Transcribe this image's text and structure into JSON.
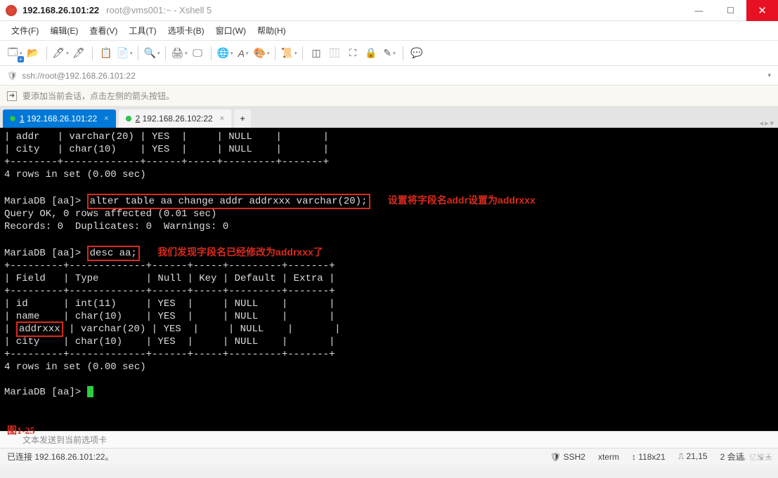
{
  "window": {
    "title_ip": "192.168.26.101:22",
    "title_sub": "root@vms001:~ - Xshell 5",
    "min": "—",
    "max": "☐",
    "close": "✕"
  },
  "menu": {
    "file": "文件(F)",
    "edit": "编辑(E)",
    "view": "查看(V)",
    "tools": "工具(T)",
    "tabs": "选项卡(B)",
    "window": "窗口(W)",
    "help": "帮助(H)"
  },
  "toolbar_icons": {
    "new_session": "🗔",
    "open": "📂",
    "reconnect": "🖊",
    "disconnect": "🖊",
    "copy": "📋",
    "paste": "📄",
    "find": "🔍",
    "print": "🖨",
    "properties": "🖵",
    "globe": "🌐",
    "font": "A",
    "colors": "🎨",
    "script": "📜",
    "layout1": "◫",
    "layout2": "⿲",
    "fullscreen": "⛶",
    "lock": "🔒",
    "highlight": "✎",
    "chat": "💬"
  },
  "addressbar": {
    "lock_icon": "🛡",
    "url": "ssh://root@192.168.26.101:22",
    "dd": "▾"
  },
  "tipbar": {
    "arrow": "➜",
    "text": "要添加当前会话，点击左侧的箭头按钮。"
  },
  "tabs": {
    "t1_num": "1",
    "t1_label": " 192.168.26.101:22",
    "t2_num": "2",
    "t2_label": " 192.168.26.102:22",
    "add": "+",
    "nav_left": "◂",
    "nav_right": "▸",
    "nav_dd": "▾"
  },
  "terminal": {
    "l1": "| addr   | varchar(20) | YES  |     | NULL    |       |",
    "l2": "| city   | char(10)    | YES  |     | NULL    |       |",
    "l3": "+--------+-------------+------+-----+---------+-------+",
    "l4": "4 rows in set (0.00 sec)",
    "p1": "MariaDB [aa]> ",
    "cmd1": "alter table aa change addr addrxxx varchar(20);",
    "ann1": "设置将字段名addr设置为addrxxx",
    "l6": "Query OK, 0 rows affected (0.01 sec)",
    "l7": "Records: 0  Duplicates: 0  Warnings: 0",
    "p2": "MariaDB [aa]> ",
    "cmd2": "desc aa;",
    "ann2": "我们发现字段名已经修改为addrxxx了",
    "h1": "+---------+-------------+------+-----+---------+-------+",
    "h2": "| Field   | Type        | Null | Key | Default | Extra |",
    "h3": "+---------+-------------+------+-----+---------+-------+",
    "r1": "| id      | int(11)     | YES  |     | NULL    |       |",
    "r2": "| name    | char(10)    | YES  |     | NULL    |       |",
    "r3a": "| ",
    "r3_field": "addrxxx",
    "r3b": " | varchar(20) | YES  |     | NULL    |       |",
    "r4": "| city    | char(10)    | YES  |     | NULL    |       |",
    "h4": "+---------+-------------+------+-----+---------+-------+",
    "l8": "4 rows in set (0.00 sec)",
    "p3": "MariaDB [aa]> "
  },
  "figure_label": "图1-25",
  "inputbar_text": "文本发送到当前选项卡",
  "statusbar": {
    "connected": "已连接 192.168.26.101:22。",
    "ssh_icon": "🛡",
    "ssh": "SSH2",
    "term": "xterm",
    "size_icon": "↕",
    "size": "118x21",
    "pos_icon": "⎍",
    "pos": "21,15",
    "sessions": "2 会话",
    "grip": "↘",
    "grip2": "+"
  },
  "watermark": {
    "cloud": "☁",
    "text": "亿速云"
  }
}
